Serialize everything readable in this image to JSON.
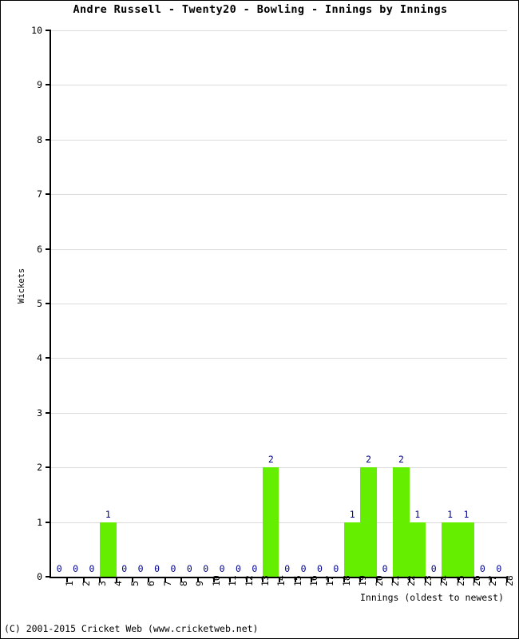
{
  "chart_data": {
    "type": "bar",
    "title": "Andre Russell - Twenty20 - Bowling - Innings by Innings",
    "xlabel": "Innings (oldest to newest)",
    "ylabel": "Wickets",
    "categories": [
      "1",
      "2",
      "3",
      "4",
      "5",
      "6",
      "7",
      "8",
      "9",
      "10",
      "11",
      "12",
      "13",
      "14",
      "15",
      "16",
      "17",
      "18",
      "19",
      "20",
      "21",
      "22",
      "23",
      "24",
      "25",
      "26",
      "27",
      "28"
    ],
    "values": [
      0,
      0,
      0,
      1,
      0,
      0,
      0,
      0,
      0,
      0,
      0,
      0,
      0,
      2,
      0,
      0,
      0,
      0,
      1,
      2,
      0,
      2,
      1,
      0,
      1,
      1,
      0,
      0
    ],
    "value_labels": [
      "0",
      "0",
      "0",
      "1",
      "0",
      "0",
      "0",
      "0",
      "0",
      "0",
      "0",
      "0",
      "0",
      "2",
      "0",
      "0",
      "0",
      "0",
      "1",
      "2",
      "0",
      "2",
      "1",
      "0",
      "1",
      "1",
      "0",
      "0"
    ],
    "ylim": [
      0,
      10
    ],
    "y_ticks": [
      0,
      1,
      2,
      3,
      4,
      5,
      6,
      7,
      8,
      9,
      10
    ],
    "y_tick_labels": [
      "0",
      "1",
      "2",
      "3",
      "4",
      "5",
      "6",
      "7",
      "8",
      "9",
      "10"
    ],
    "grid": true,
    "legend": null,
    "bar_color": "#66ee00",
    "value_label_color": "#00008b",
    "gridline_color": "#dcdcdc",
    "axis_color": "#000000"
  },
  "footer": {
    "copyright": "(C) 2001-2015 Cricket Web (www.cricketweb.net)"
  }
}
